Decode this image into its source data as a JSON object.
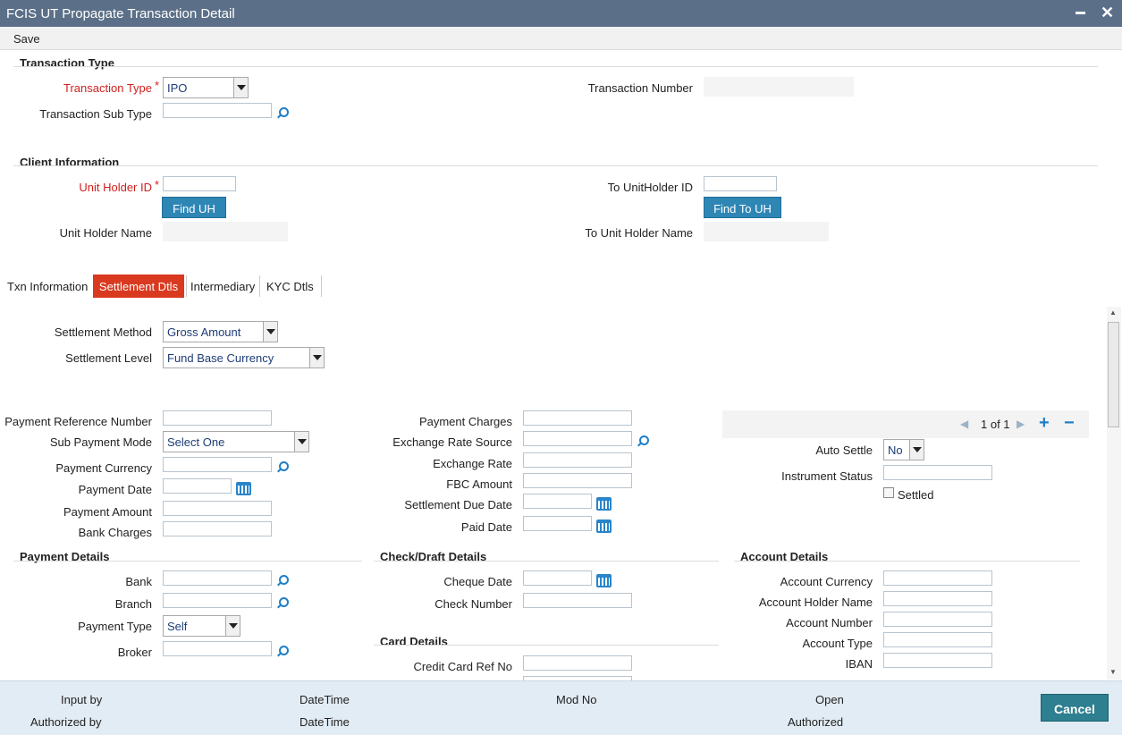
{
  "window": {
    "title": "FCIS UT Propagate Transaction Detail"
  },
  "menu": {
    "save": "Save"
  },
  "txn_type": {
    "section": "Transaction Type",
    "type_label": "Transaction Type",
    "type_value": "IPO",
    "subtype_label": "Transaction Sub Type",
    "number_label": "Transaction Number"
  },
  "client": {
    "section": "Client Information",
    "uh_id_label": "Unit Holder ID",
    "find_uh": "Find UH",
    "uh_name_label": "Unit Holder Name",
    "to_uh_id_label": "To UnitHolder ID",
    "find_to_uh": "Find To UH",
    "to_uh_name_label": "To Unit Holder Name"
  },
  "tabs": [
    "Txn Information",
    "Settlement Dtls",
    "Intermediary",
    "KYC Dtls"
  ],
  "settlement": {
    "method_label": "Settlement Method",
    "method_value": "Gross Amount",
    "level_label": "Settlement Level",
    "level_value": "Fund Base Currency"
  },
  "payment": {
    "ref_no": "Payment Reference Number",
    "sub_mode": "Sub Payment Mode",
    "sub_mode_value": "Select One",
    "currency": "Payment Currency",
    "date": "Payment Date",
    "amount": "Payment Amount",
    "bank_charges": "Bank Charges"
  },
  "middle": {
    "charges": "Payment Charges",
    "xr_source": "Exchange Rate Source",
    "xr": "Exchange Rate",
    "fbc": "FBC Amount",
    "due_date": "Settlement Due Date",
    "paid_date": "Paid Date"
  },
  "pager": {
    "text": "1 of 1"
  },
  "right": {
    "auto_settle": "Auto Settle",
    "auto_settle_value": "No",
    "instr_status": "Instrument Status",
    "settled": "Settled"
  },
  "payment_details": {
    "section": "Payment Details",
    "bank": "Bank",
    "branch": "Branch",
    "type": "Payment Type",
    "type_value": "Self",
    "broker": "Broker"
  },
  "check_details": {
    "section": "Check/Draft Details",
    "cheque_date": "Cheque Date",
    "check_number": "Check Number"
  },
  "card_details": {
    "section": "Card Details",
    "cc_ref": "Credit Card Ref No"
  },
  "account_details": {
    "section": "Account Details",
    "currency": "Account Currency",
    "holder": "Account Holder Name",
    "number": "Account Number",
    "type": "Account Type",
    "iban": "IBAN"
  },
  "footer": {
    "input_by": "Input by",
    "authorized_by": "Authorized by",
    "datetime1": "DateTime",
    "datetime2": "DateTime",
    "mod_no": "Mod No",
    "open": "Open",
    "authorized": "Authorized",
    "cancel": "Cancel"
  },
  "colors": {
    "titlebar": "#5b7088",
    "active_tab": "#d93a1f",
    "button": "#2e86b5",
    "cancel": "#2e7f8f",
    "required": "#d0201d"
  }
}
